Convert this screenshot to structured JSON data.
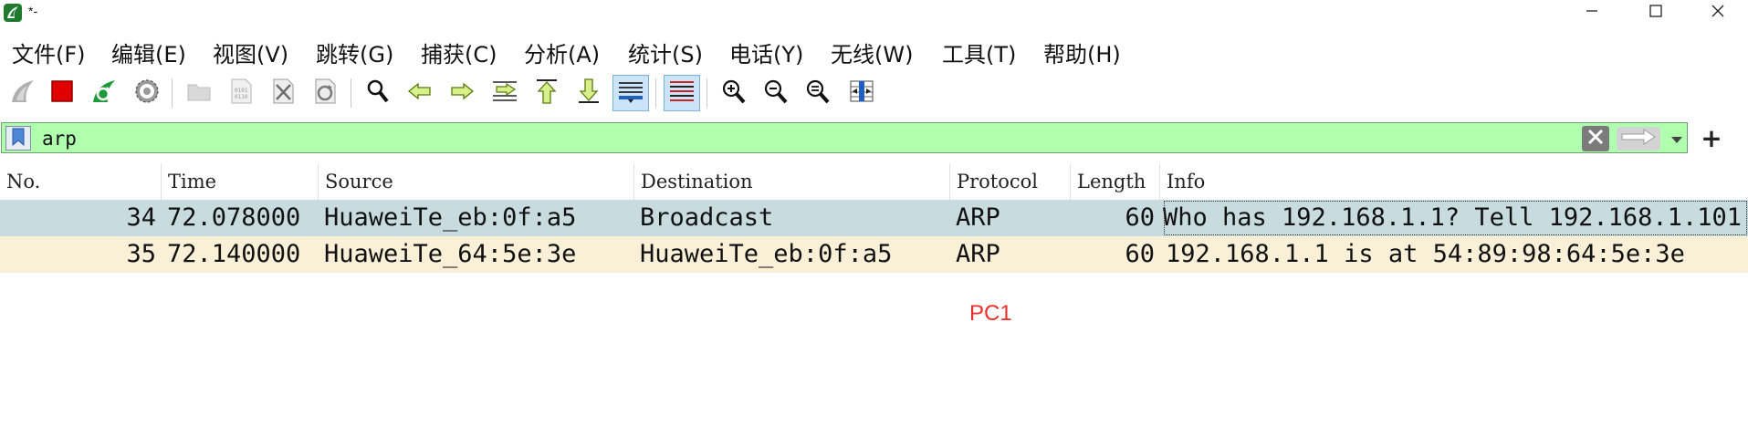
{
  "window": {
    "title": "*-",
    "icons": {
      "app": "wireshark-fin-icon",
      "minimize": "minimize-icon",
      "maximize": "maximize-icon",
      "close": "close-icon"
    }
  },
  "menu": {
    "items": [
      "文件(F)",
      "编辑(E)",
      "视图(V)",
      "跳转(G)",
      "捕获(C)",
      "分析(A)",
      "统计(S)",
      "电话(Y)",
      "无线(W)",
      "工具(T)",
      "帮助(H)"
    ]
  },
  "toolbar": {
    "icons": [
      "start-capture-icon",
      "stop-capture-icon",
      "restart-capture-icon",
      "capture-options-icon",
      "open-file-icon",
      "save-file-icon",
      "close-file-icon",
      "reload-file-icon",
      "find-packet-icon",
      "go-back-icon",
      "go-forward-icon",
      "go-to-packet-icon",
      "go-first-packet-icon",
      "go-last-packet-icon",
      "auto-scroll-icon",
      "colorize-icon",
      "zoom-in-icon",
      "zoom-out-icon",
      "zoom-normal-icon",
      "resize-columns-icon"
    ],
    "active": [
      "auto-scroll-icon",
      "colorize-icon"
    ]
  },
  "filter": {
    "value": "arp",
    "background": "#afffaf",
    "plus_label": "+"
  },
  "packet_list": {
    "columns": [
      "No.",
      "Time",
      "Source",
      "Destination",
      "Protocol",
      "Length",
      "Info"
    ],
    "rows": [
      {
        "no": "34",
        "time": "72.078000",
        "source": "HuaweiTe_eb:0f:a5",
        "destination": "Broadcast",
        "protocol": "ARP",
        "length": "60",
        "info": "Who has 192.168.1.1? Tell 192.168.1.101",
        "background": "#c8dce0"
      },
      {
        "no": "35",
        "time": "72.140000",
        "source": "HuaweiTe_64:5e:3e",
        "destination": "HuaweiTe_eb:0f:a5",
        "protocol": "ARP",
        "length": "60",
        "info": "192.168.1.1 is at 54:89:98:64:5e:3e",
        "background": "#faf0d7"
      }
    ]
  },
  "annotation": {
    "text": "PC1",
    "color": "#e8302a"
  }
}
